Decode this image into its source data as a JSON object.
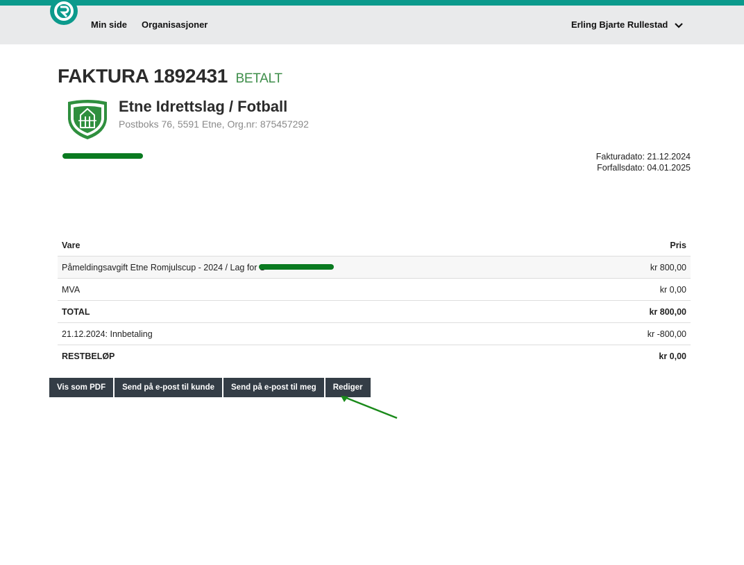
{
  "nav": {
    "links": [
      "Min side",
      "Organisasjoner"
    ],
    "user": "Erling Bjarte Rullestad"
  },
  "invoice": {
    "title": "FAKTURA 1892431",
    "status": "BETALT",
    "club_name": "Etne Idrettslag / Fotball",
    "club_address": "Postboks 76, 5591 Etne, Org.nr: 875457292",
    "invoice_date": "Fakturadato: 21.12.2024",
    "due_date": "Forfallsdato: 04.01.2025"
  },
  "table": {
    "headers": [
      "Vare",
      "Pris"
    ],
    "rows": [
      {
        "label": "Påmeldingsavgift Etne Romjulscup - 2024 / Lag for S",
        "price": "kr 800,00"
      },
      {
        "label": "MVA",
        "price": "kr 0,00"
      },
      {
        "label": "TOTAL",
        "price": "kr 800,00"
      },
      {
        "label": "21.12.2024: Innbetaling",
        "price": "kr -800,00"
      },
      {
        "label": "RESTBELØP",
        "price": "kr 0,00"
      }
    ]
  },
  "buttons": [
    "Vis som PDF",
    "Send på e-post til kunde",
    "Send på e-post til meg",
    "Rediger"
  ],
  "colors": {
    "brand": "#0b9a8c",
    "paid": "#3e8e4a",
    "button": "#343d46",
    "redaction": "#0a7a20"
  },
  "icons": [
    "app-logo-icon",
    "chevron-down-icon",
    "club-crest-icon",
    "annotation-arrow-icon"
  ]
}
